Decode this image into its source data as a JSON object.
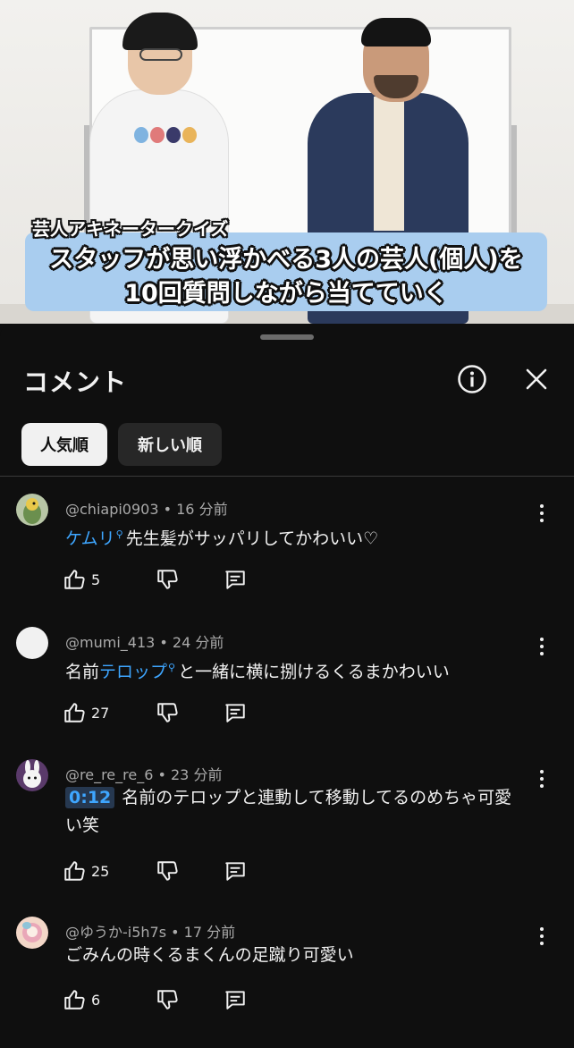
{
  "video": {
    "caption_small": "芸人アキネータークイズ",
    "caption_line1": "スタッフが思い浮かべる3人の芸人(個人)を",
    "caption_line2": "10回質問しながら当てていく"
  },
  "sheet": {
    "title": "コメント",
    "chips": [
      {
        "label": "人気順",
        "selected": true
      },
      {
        "label": "新しい順",
        "selected": false
      }
    ]
  },
  "comments": [
    {
      "handle": "@chiapi0903",
      "time": "16 分前",
      "meta": "@chiapi0903 • 16 分前",
      "link_text": "ケムリ",
      "text": "先生髪がサッパリしてかわいい♡",
      "likes": "5",
      "avatar_color": "#6b8f4e"
    },
    {
      "handle": "@mumi_413",
      "time": "24 分前",
      "meta": "@mumi_413 • 24 分前",
      "prefix": "名前",
      "link_text": "テロップ",
      "text": "と一緒に横に捌けるくるまかわいい",
      "likes": "27",
      "avatar_color": "#f1f1f1"
    },
    {
      "handle": "@re_re_re_6",
      "time": "23 分前",
      "meta": "@re_re_re_6 • 23 分前",
      "timestamp": "0:12",
      "text_line1": "名前のテロップと連動して移動してるのめちゃ可愛",
      "text_line2": "い笑",
      "likes": "25",
      "avatar_color": "#6a4a7a"
    },
    {
      "handle": "@ゆうか-i5h7s",
      "time": "17 分前",
      "meta": "@ゆうか-i5h7s • 17 分前",
      "text": "ごみんの時くるまくんの足蹴り可愛い",
      "likes": "6",
      "avatar_color": "#e9a7b8"
    }
  ]
}
